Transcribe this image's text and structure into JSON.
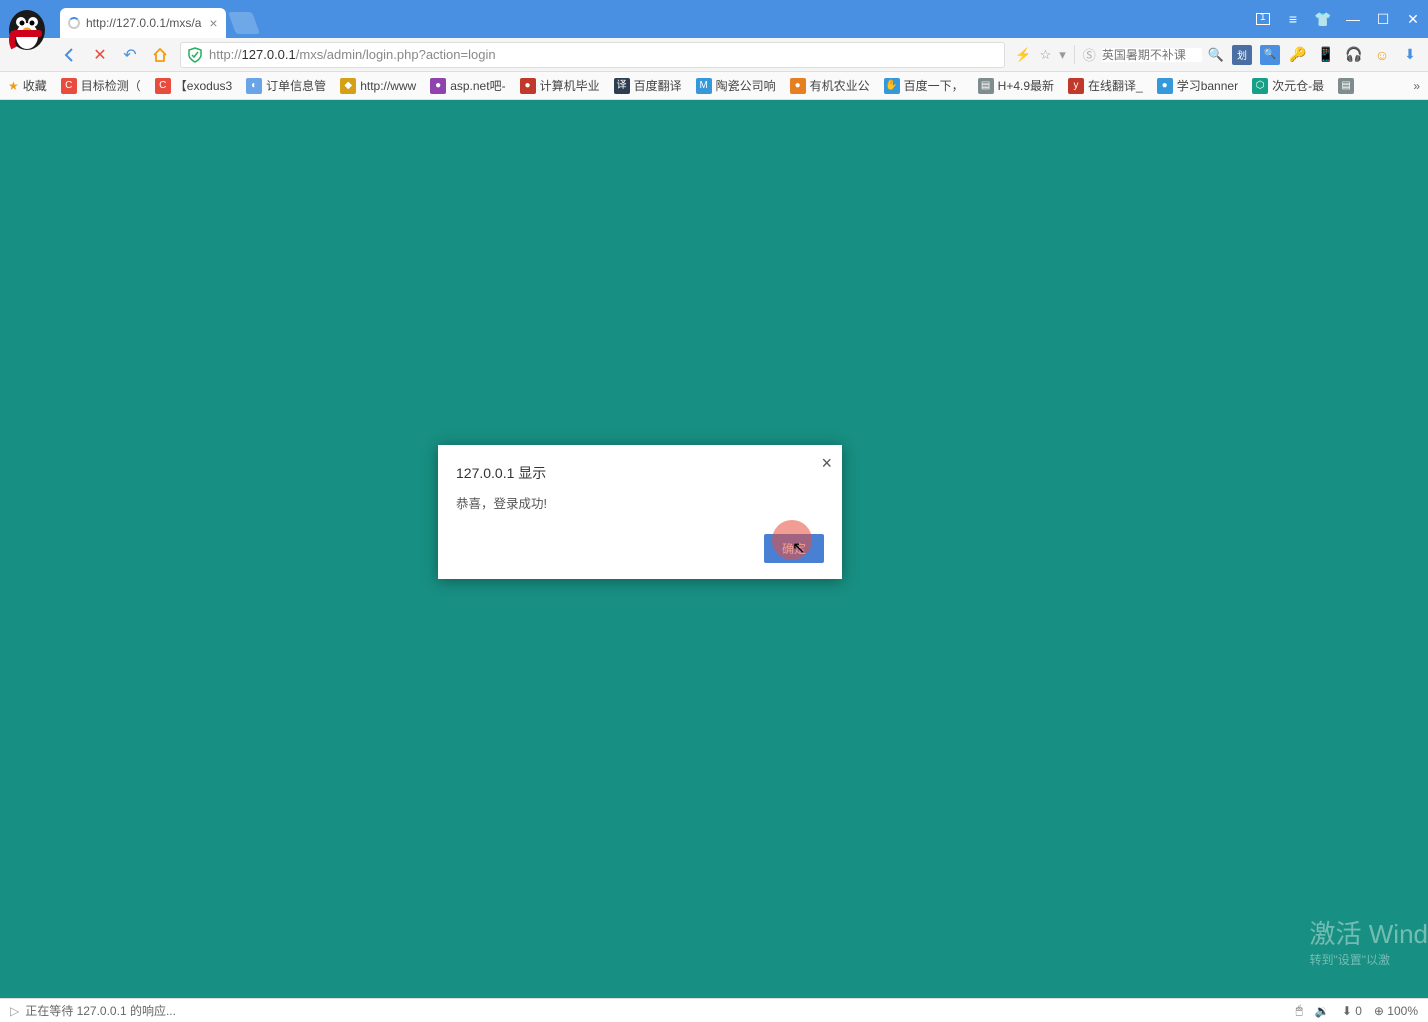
{
  "tab": {
    "title": "http://127.0.0.1/mxs/a"
  },
  "url": {
    "prefix": "http://",
    "host": "127.0.0.1",
    "path": "/mxs/admin/login.php?action=login"
  },
  "search": {
    "placeholder": "英国暑期不补课"
  },
  "bookmarks": {
    "fav_label": "收藏",
    "items": [
      {
        "label": "目标检测（",
        "color": "#e74c3c",
        "glyph": "C"
      },
      {
        "label": "【exodus3",
        "color": "#e74c3c",
        "glyph": "C"
      },
      {
        "label": "订单信息管",
        "color": "#6aa4e8",
        "glyph": "◐"
      },
      {
        "label": "http://www",
        "color": "#d4a017",
        "glyph": "◆"
      },
      {
        "label": "asp.net吧-",
        "color": "#8e44ad",
        "glyph": "●"
      },
      {
        "label": "计算机毕业",
        "color": "#c0392b",
        "glyph": "●"
      },
      {
        "label": "百度翻译",
        "color": "#2c3e50",
        "glyph": "译"
      },
      {
        "label": "陶瓷公司响",
        "color": "#3498db",
        "glyph": "M"
      },
      {
        "label": "有机农业公",
        "color": "#e67e22",
        "glyph": "●"
      },
      {
        "label": "百度一下，",
        "color": "#3498db",
        "glyph": "✋"
      },
      {
        "label": "H+4.9最新",
        "color": "#7f8c8d",
        "glyph": "▤"
      },
      {
        "label": "在线翻译_",
        "color": "#c0392b",
        "glyph": "y"
      },
      {
        "label": "学习banner",
        "color": "#3498db",
        "glyph": "●"
      },
      {
        "label": "次元仓-最",
        "color": "#16a085",
        "glyph": "⬡"
      },
      {
        "label": "",
        "color": "#7f8c8d",
        "glyph": "▤"
      }
    ]
  },
  "dialog": {
    "title": "127.0.0.1 显示",
    "message": "恭喜，登录成功!",
    "ok": "确定"
  },
  "watermark": {
    "line1": "激活 Wind",
    "line2": "转到\"设置\"以激"
  },
  "status": {
    "left": "正在等待 127.0.0.1 的响应...",
    "zoom": "100%",
    "speed": "0"
  }
}
